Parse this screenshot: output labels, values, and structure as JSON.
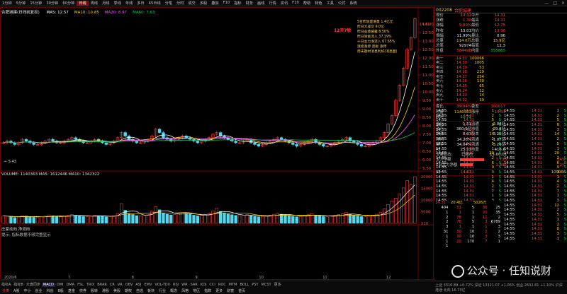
{
  "toolbar": {
    "items": [
      "1分钟",
      "5分钟",
      "15分钟",
      "30分钟",
      "60分钟",
      "日线",
      "周线",
      "月线",
      "季线",
      "年线",
      "多日",
      "45日线",
      "分笔",
      "分时",
      "成交",
      "多股",
      "叠加",
      "F10",
      "指标",
      "财务",
      "画线",
      "行情",
      "资讯",
      "F10",
      "帮助",
      "特色",
      "工具",
      "公式",
      "系统"
    ],
    "active_index": 5,
    "win_controls": [
      "—",
      "□",
      "×"
    ]
  },
  "chart": {
    "title": "合肥城建(日线前复权)",
    "ma_legend": [
      {
        "label": "MA5: 12.57",
        "color": "#ffffff"
      },
      {
        "label": "MA10: 10.85",
        "color": "#ffd000"
      },
      {
        "label": "MA20: 8.97",
        "color": "#ff4fff"
      },
      {
        "label": "MA60: 7.63",
        "color": "#00d15a"
      }
    ],
    "price_axis": [
      "14.00",
      "13.50",
      "13.00",
      "12.50",
      "12.00",
      "11.50",
      "11.00",
      "10.50",
      "10.00",
      "9.50",
      "9.00",
      "8.50",
      "8.00",
      "7.50",
      "7.00",
      "6.50",
      "6.00",
      "5.50"
    ],
    "low_label": "← 5.43",
    "high_label": "14.31",
    "annotation_tag": "12天7板",
    "annotation_lines": [
      "5合昨放量增量 1.4亿元",
      "昨日大成交 9.0亿",
      "昨日业绩披露 8.50%",
      "昨日资金流入 37.19%",
      "十日主力净流入 67.55%",
      "连续涨停 连板 涨停",
      "周末题材消息利好(消息面)"
    ],
    "volume_legend": "VOLUME: 1140363  MA5: 1612446  MA10: 1342322",
    "volume_axis": [
      "20000",
      "15000",
      "10000",
      "5000",
      "X10"
    ],
    "sub_legend": "庄家动向  净流向",
    "sub_tip": "提示: 指标数据不够完整显示",
    "date_axis": [
      "2020/6",
      "7",
      "8",
      "9",
      "10",
      "11",
      "12"
    ]
  },
  "chart_data": {
    "type": "bar",
    "title": "合肥城建(日线前复权)",
    "ylim": [
      5.5,
      14.5
    ],
    "series": [
      {
        "name": "MA5",
        "color": "#ffffff"
      },
      {
        "name": "MA10",
        "color": "#ffd000"
      },
      {
        "name": "MA20",
        "color": "#ff4fff"
      },
      {
        "name": "MA60",
        "color": "#00d15a"
      }
    ],
    "close": [
      7.0,
      7.1,
      7.0,
      6.9,
      7.0,
      7.2,
      7.1,
      7.0,
      6.9,
      6.9,
      7.0,
      7.1,
      7.2,
      7.1,
      7.0,
      7.0,
      7.1,
      7.2,
      7.3,
      7.2,
      7.1,
      7.0,
      7.0,
      7.1,
      7.2,
      7.1,
      7.0,
      6.9,
      7.0,
      7.1,
      7.3,
      7.6,
      7.4,
      7.2,
      7.1,
      7.0,
      7.0,
      7.1,
      7.2,
      7.4,
      7.8,
      7.6,
      7.3,
      7.2,
      7.1,
      7.2,
      7.3,
      7.4,
      7.3,
      7.2,
      7.1,
      7.0,
      7.1,
      7.2,
      7.3,
      7.5,
      7.6,
      7.4,
      7.3,
      7.2,
      7.1,
      7.0,
      7.0,
      7.1,
      7.2,
      7.0,
      6.9,
      6.8,
      6.9,
      7.0,
      7.1,
      7.2,
      7.3,
      7.2,
      7.1,
      7.0,
      6.9,
      6.8,
      6.9,
      7.0,
      7.1,
      7.2,
      7.0,
      6.9,
      6.8,
      6.8,
      6.9,
      7.0,
      7.1,
      7.2,
      7.3,
      7.1,
      7.0,
      6.9,
      6.8,
      6.8,
      6.9,
      7.0,
      7.1,
      7.3,
      7.6,
      8.1,
      8.6,
      9.5,
      10.4,
      11.4,
      12.5,
      13.2,
      14.31
    ],
    "volume": [
      3200,
      3000,
      2800,
      2500,
      2700,
      3300,
      3100,
      2900,
      2600,
      2500,
      2800,
      3100,
      3600,
      3200,
      2900,
      2800,
      3000,
      3400,
      3800,
      3500,
      3200,
      2900,
      2800,
      3000,
      3400,
      3300,
      3000,
      2800,
      2900,
      3200,
      4200,
      8500,
      5600,
      4200,
      3800,
      3300,
      3200,
      3400,
      3900,
      5200,
      7200,
      5800,
      4500,
      3900,
      3600,
      3800,
      4100,
      4600,
      4200,
      3900,
      3500,
      3200,
      3400,
      3700,
      4100,
      5200,
      6400,
      5100,
      4500,
      4000,
      3700,
      3400,
      3300,
      3500,
      3800,
      3300,
      3000,
      2800,
      3000,
      3200,
      3500,
      3900,
      4300,
      3900,
      3600,
      3300,
      3000,
      2800,
      3000,
      3300,
      3700,
      4100,
      3500,
      3100,
      2900,
      2800,
      3100,
      3400,
      3800,
      4100,
      4600,
      3900,
      3500,
      3200,
      2900,
      2800,
      3100,
      3400,
      3900,
      4800,
      6200,
      8100,
      9600,
      10800,
      12500,
      15200,
      18400,
      16500,
      20000
    ]
  },
  "quote": {
    "code": "002208",
    "name": "合肥城建",
    "rows": [
      [
        {
          "l": "现价",
          "v": "14.31",
          "c": "red"
        },
        {
          "l": "今开",
          "v": "14.31",
          "c": "red"
        }
      ],
      [
        {
          "l": "涨跌",
          "v": "1.30",
          "c": "red"
        },
        {
          "l": "最高",
          "v": "14.31",
          "c": "red"
        }
      ],
      [
        {
          "l": "涨幅",
          "v": "9.99%",
          "c": "red"
        },
        {
          "l": "最低",
          "v": "12.75",
          "c": "red"
        }
      ],
      [
        {
          "l": "昨收",
          "v": "13.01",
          "c": "wht"
        },
        {
          "l": "均价",
          "v": "13.96",
          "c": "red"
        }
      ],
      [
        {
          "l": "振幅",
          "v": "11.99%",
          "c": "wht"
        },
        {
          "l": "量比",
          "v": "0.96",
          "c": "wht"
        }
      ],
      [
        {
          "l": "总量",
          "v": "114.0万",
          "c": "yel"
        },
        {
          "l": "总额",
          "v": "15.9亿",
          "c": "yel"
        }
      ],
      [
        {
          "l": "总笔",
          "v": "92974",
          "c": "wht"
        },
        {
          "l": "每笔",
          "v": "12.3",
          "c": "wht"
        }
      ],
      [
        {
          "l": "外盘",
          "v": "584498",
          "c": "red"
        },
        {
          "l": "内盘",
          "v": "555865",
          "c": "grn"
        }
      ]
    ],
    "asks": [
      {
        "l": "卖一",
        "p": "14.31",
        "q": "100066",
        "c": "red"
      },
      {
        "l": "卖二",
        "p": "14.30",
        "q": "1005",
        "c": "red"
      },
      {
        "l": "卖三",
        "p": "14.29",
        "q": "53",
        "c": "red"
      },
      {
        "l": "卖四",
        "p": "14.28",
        "q": "219",
        "c": "red"
      },
      {
        "l": "卖五",
        "p": "14.27",
        "q": "254",
        "c": "red"
      },
      {
        "l": "卖六",
        "p": "14.26",
        "q": "130",
        "c": "red"
      },
      {
        "l": "卖七",
        "p": "14.25",
        "q": "65",
        "c": "red"
      },
      {
        "l": "卖八",
        "p": "14.24",
        "q": "12",
        "c": "red"
      },
      {
        "l": "卖九",
        "p": "14.23",
        "q": "14",
        "c": "red"
      },
      {
        "l": "卖十",
        "p": "14.22",
        "q": "39",
        "c": "red"
      }
    ],
    "stats": [
      [
        {
          "l": "量比",
          "v": "1.51",
          "c": "wht"
        },
        {
          "l": "流通",
          "v": "2.08亿",
          "c": "wht"
        }
      ],
      [
        {
          "l": "资产",
          "v": "360.9亿",
          "c": "wht"
        },
        {
          "l": "市值",
          "v": "29.8亿",
          "c": "wht"
        }
      ],
      [
        {
          "l": "净资",
          "v": "8.07",
          "c": "wht"
        },
        {
          "l": "股本",
          "v": "3.26亿",
          "c": "wht"
        }
      ],
      [
        {
          "l": "净利",
          "v": "14.20%",
          "c": "wht"
        },
        {
          "l": "流通",
          "v": "1.07亿",
          "c": "wht"
        }
      ],
      [
        {
          "l": "换手",
          "v": "34.94%",
          "c": "wht"
        },
        {
          "l": "流通",
          "v": "3.26亿",
          "c": "wht"
        }
      ],
      [
        {
          "l": "PE",
          "v": "25.23",
          "c": "wht"
        },
        {
          "l": "市盈",
          "v": "416.6",
          "c": "wht"
        }
      ]
    ],
    "trade_status_label": "交易状态:",
    "trade_status_value": "已闭市",
    "trade_status_time": "15:00:01",
    "flows": [
      {
        "l": "主力净额",
        "v": "3.73亿",
        "pct": "24%",
        "c": "red",
        "w": 34
      },
      {
        "l": "5日主力净额",
        "v": "2.49亿",
        "pct": "2%",
        "c": "red",
        "w": 18
      }
    ],
    "misc": [
      {
        "l": "委比",
        "v": "99.94%",
        "c": "red"
      },
      {
        "l": "委差",
        "v": "100017",
        "c": "red"
      },
      {
        "l": "总量",
        "v": "1140363",
        "c": "yel"
      },
      {
        "l": "涨停",
        "v": "14.31",
        "c": "red"
      },
      {
        "l": "跌停",
        "v": "11.71",
        "c": "grn"
      }
    ],
    "bid_label": "买一",
    "bid_price": "14.31",
    "bid_qty": "100066",
    "ticks": [
      {
        "t": "14:55",
        "p": "14.31",
        "q": "1",
        "d": "S"
      },
      {
        "t": "14:55",
        "p": "14.31",
        "q": "2",
        "d": "S"
      },
      {
        "t": "14:55",
        "p": "14.31",
        "q": "5",
        "d": "S"
      },
      {
        "t": "14:55",
        "p": "14.31",
        "q": "8",
        "d": "S"
      },
      {
        "t": "14:55",
        "p": "14.31",
        "q": "3",
        "d": "S"
      },
      {
        "t": "14:55",
        "p": "14.31",
        "q": "14",
        "d": "S"
      },
      {
        "t": "14:55",
        "p": "14.31",
        "q": "2",
        "d": "S"
      },
      {
        "t": "14:55",
        "p": "14.31",
        "q": "5",
        "d": "S"
      },
      {
        "t": "14:55",
        "p": "14.31",
        "q": "1",
        "d": "S"
      },
      {
        "t": "14:55",
        "p": "14.31",
        "q": "20",
        "d": "S"
      },
      {
        "t": "14:55",
        "p": "14.31",
        "q": "2",
        "d": "S"
      },
      {
        "t": "14:55",
        "p": "14.31",
        "q": "6",
        "d": "S"
      },
      {
        "t": "14:55",
        "p": "14.31",
        "q": "9",
        "d": "S"
      },
      {
        "t": "14:55",
        "p": "14.31",
        "q": "3",
        "d": "S"
      },
      {
        "t": "14:55",
        "p": "14.31",
        "q": "1",
        "d": "S"
      },
      {
        "t": "14:55",
        "p": "14.31",
        "q": "4",
        "d": "S"
      },
      {
        "t": "14:55",
        "p": "14.31",
        "q": "2",
        "d": "S"
      },
      {
        "t": "14:55",
        "p": "14.31",
        "q": "7",
        "d": "S"
      },
      {
        "t": "14:55",
        "p": "14.31",
        "q": "1",
        "d": "S"
      },
      {
        "t": "14:55",
        "p": "14.31",
        "q": "3",
        "d": "S"
      },
      {
        "t": "14:55",
        "p": "14.31",
        "q": "12",
        "d": "S"
      },
      {
        "t": "14:55",
        "p": "14.31",
        "q": "2",
        "d": "S"
      },
      {
        "t": "14:55",
        "p": "14.31",
        "q": "5",
        "d": "S"
      },
      {
        "t": "14:55",
        "p": "14.31",
        "q": "1",
        "d": "S"
      },
      {
        "t": "14:55",
        "p": "14.31",
        "q": "2",
        "d": "S"
      },
      {
        "t": "14:55",
        "p": "14.31",
        "q": "8",
        "d": "S"
      },
      {
        "t": "14:55",
        "p": "14.31",
        "q": "3",
        "d": "S"
      },
      {
        "t": "14:55",
        "p": "14.31",
        "q": "1",
        "d": "S"
      }
    ],
    "depth_rows": [
      [
        "404",
        "51",
        "5",
        "36",
        "25"
      ],
      [
        "1",
        "1",
        "1",
        "20",
        "35"
      ],
      [
        "2",
        "78",
        "1",
        "11",
        "2"
      ],
      [
        "2",
        "78",
        "5",
        "3",
        "6789"
      ],
      [
        "3",
        "1",
        "1",
        "1",
        "3"
      ],
      [
        "31",
        "30",
        "10",
        "2",
        "2"
      ],
      [
        "1",
        "30",
        "10",
        "3",
        "3"
      ],
      [
        "1",
        "20",
        "170",
        "7",
        "1"
      ],
      [
        "1",
        "",
        "",
        "",
        ""
      ]
    ],
    "depth_header": [
      "14.31",
      "20.4亿",
      "5026万"
    ]
  },
  "bottom": {
    "indicators": [
      "指标A",
      "指标B",
      "大盘同步",
      "MACD",
      "DMI",
      "DMA",
      "FSL",
      "TRIX",
      "BRAR",
      "CR",
      "VR",
      "OBV",
      "ASI",
      "EMV",
      "VOL-TDX",
      "RSI",
      "WR",
      "SAR",
      "KDJ",
      "CCI",
      "ROC",
      "MTM",
      "BOLL",
      "PSY",
      "MCST",
      "更多"
    ],
    "indicator_on": 3,
    "tabs": [
      "分类",
      "A股",
      "中小",
      "创业",
      "科创",
      "B股",
      "基金",
      "债券",
      "股转",
      "港股",
      "美股",
      "期权",
      "自选",
      "板块",
      "行业",
      "概念",
      "风格",
      "地区",
      "指数",
      "更多",
      "财富",
      "首页"
    ],
    "tab_on": 0,
    "status_text": "上证 3316.89 +0.72%  深证 13321.07 +1.06%  创业 2632.81 +1.10%  沪深港通 北向 16.73亿"
  },
  "watermark": "公众号 · 任知说财"
}
